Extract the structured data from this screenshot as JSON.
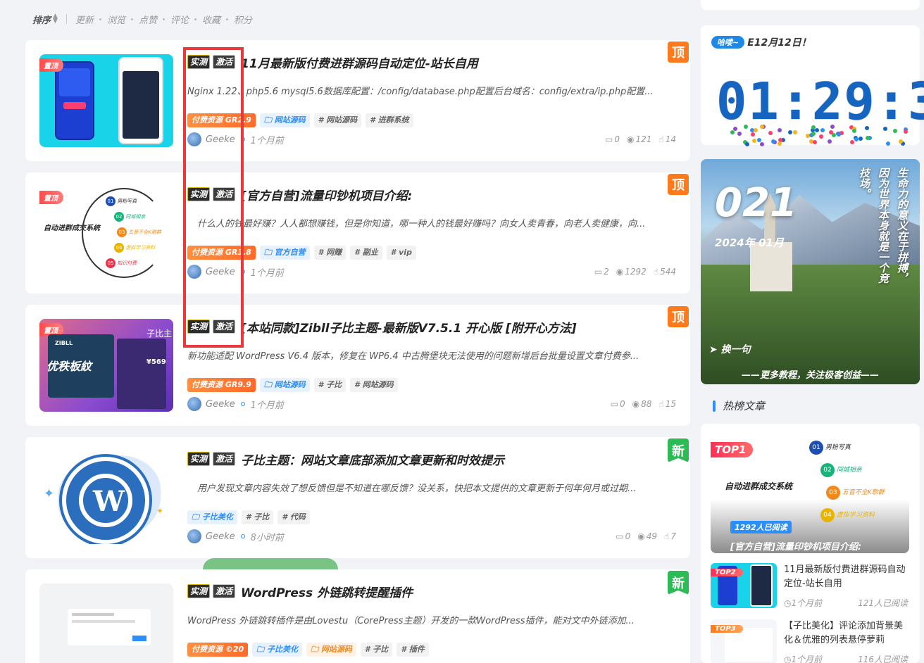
{
  "sortbar": {
    "label": "排序",
    "options": [
      "更新",
      "浏览",
      "点赞",
      "评论",
      "收藏",
      "积分"
    ]
  },
  "tags": {
    "test": "实测",
    "activate": "激活",
    "pinned": "置顶"
  },
  "posts": [
    {
      "title": "11月最新版付费进群源码自动定位-站长自用",
      "excerpt": "Nginx 1.22、php5.6 mysql5.6数据库配置：/config/database.php配置后台域名：config/extra/ip.php配置...",
      "tags": [
        "付费资源 GR2.9",
        "网站源码",
        "# 网站源码",
        "# 进群系统"
      ],
      "author": "Geeke",
      "time": "1个月前",
      "comments": "0",
      "views": "121",
      "likes": "14",
      "flag": "顶"
    },
    {
      "title": "[官方自营]流量印钞机项目介绍:",
      "excerpt": "什么人的钱最好赚？人人都想赚钱，但是你知道，哪一种人的钱最好赚吗？向女人卖青春，向老人卖健康，向...",
      "tags": [
        "付费资源 GR3.8",
        "官方自营",
        "# 网赚",
        "# 副业",
        "# vip"
      ],
      "author": "Geeke",
      "time": "1个月前",
      "comments": "2",
      "views": "1292",
      "likes": "544",
      "flag": "顶"
    },
    {
      "title": "[本站同款]Zibll子比主题-最新版V7.5.1 开心版 [附开心方法]",
      "excerpt": "新功能适配 WordPress V6.4 版本，修复在 WP6.4 中古腾堡块无法使用的问题新增后台批量设置文章付费参...",
      "tags": [
        "付费资源 GR9.9",
        "网站源码",
        "# 子比",
        "# 网站源码"
      ],
      "author": "Geeke",
      "time": "1个月前",
      "comments": "0",
      "views": "88",
      "likes": "15",
      "flag": "顶"
    },
    {
      "title": "子比主题：网站文章底部添加文章更新和时效提示",
      "excerpt": "用户发现文章内容失效了想反馈但是不知道在哪反馈？没关系，快把本文提供的文章更新于何年何月或过期...",
      "tags": [
        "子比美化",
        "# 子比",
        "# 代码"
      ],
      "author": "Geeke",
      "time": "8小时前",
      "comments": "0",
      "views": "49",
      "likes": "7",
      "flag": "新"
    },
    {
      "title": "WordPress 外链跳转提醒插件",
      "excerpt": "WordPress 外链跳转插件是由Lovestu（CorePress主题）开发的一款WordPress插件，能对文中外链添加...",
      "tags": [
        "付费资源 ©20",
        "子比美化",
        "网站源码",
        "# 子比",
        "# 插件"
      ],
      "flag": "新"
    }
  ],
  "thumb2": {
    "heading": "自动进群成交系统",
    "steps": [
      "男粉写真",
      "同城相亲",
      "五音不全K歌群",
      "虚拟学习资料",
      "知识付费"
    ],
    "nums": [
      "01",
      "02",
      "03",
      "04",
      "05"
    ]
  },
  "thumb3": {
    "brand": "ZIBLL",
    "slogan": "优秩板紋",
    "price": "¥569",
    "side": "子比主"
  },
  "sidebar": {
    "greet_pill": "哈喽~",
    "greet_text": "E12月12日！",
    "clock": "01:29:3",
    "banner": {
      "num": "021",
      "date": "2024年 01月",
      "vertical": [
        "生命力的意义在于拼搏，",
        "因为世界本身就是一个竞",
        "技场。"
      ],
      "change": "换一句",
      "footer": "——更多教程，关注极客创益——"
    },
    "hot_title": "热榜文章",
    "top1": {
      "label": "TOP1",
      "reads": "1292人已阅读",
      "title": "[官方自营]流量印钞机项目介绍:"
    },
    "hot_items": [
      {
        "label": "TOP2",
        "title": "11月最新版付费进群源码自动定位-站长自用",
        "time": "1个月前",
        "reads": "121人已阅读"
      },
      {
        "label": "TOP3",
        "title": "【子比美化】评论添加背景美化＆优雅的列表悬停萝莉",
        "time": "1个月前",
        "reads": "116人已阅读"
      }
    ]
  },
  "colors": {
    "accent": "#2c8ef8",
    "top": "#ff7a1a",
    "new": "#2dbb55",
    "highlight": "#e83a3a"
  }
}
